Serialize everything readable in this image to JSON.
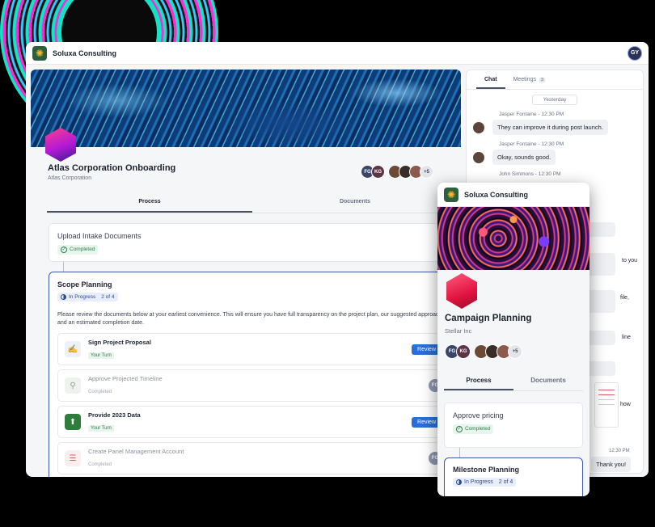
{
  "app": {
    "brand": "Soluxa Consulting",
    "user_initials": "GY",
    "accent_color": "#2a6fd6",
    "progress_color": "#3a5aa8",
    "success_color": "#2e7d4a"
  },
  "project": {
    "title": "Atlas Corporation Onboarding",
    "client": "Atlas Corporation",
    "members": [
      "FG",
      "KG"
    ],
    "more_members": "+5"
  },
  "tabs": [
    "Process",
    "Documents"
  ],
  "steps": {
    "upload": {
      "title": "Upload Intake Documents",
      "status": "Completed"
    },
    "scope": {
      "title": "Scope Planning",
      "status": "In Progress",
      "count": "2 of 4",
      "description": "Please review the documents below at your earliest convenience. This will ensure you have full transparency on the project plan, our suggested approach, and an estimated completion date."
    }
  },
  "tasks": [
    {
      "title": "Sign Project Proposal",
      "status": "Your Turn",
      "action": "Review",
      "icon": "signature-icon"
    },
    {
      "title": "Approve Projected Timeline",
      "status": "Completed",
      "assignee": "FG",
      "icon": "stamp-icon"
    },
    {
      "title": "Provide 2023 Data",
      "status": "Your Turn",
      "action": "Review",
      "icon": "upload-file-icon"
    },
    {
      "title": "Create Panel Management Account",
      "status": "Completed",
      "assignee": "FG",
      "icon": "form-icon"
    }
  ],
  "chat": {
    "tabs": {
      "chat": "Chat",
      "meetings": "Meetings",
      "meetings_count": "3"
    },
    "day": "Yesterday",
    "messages": [
      {
        "meta": "Jasper Fontaine - 12:30 PM",
        "text": "They can improve it during post launch."
      },
      {
        "meta": "Jasper Fontaine - 12:30 PM",
        "text": "Okay, sounds good."
      },
      {
        "meta": "John Simmons - 12:30 PM"
      }
    ],
    "partial_texts": [
      "to you",
      "file,",
      "line",
      "how"
    ],
    "last_time": "12:30 PM",
    "last_message": "Thank you!"
  },
  "card": {
    "brand": "Soluxa Consulting",
    "title": "Campaign Planning",
    "client": "Stellar Inc",
    "members": [
      "FG",
      "KG"
    ],
    "more_members": "+5",
    "tabs": [
      "Process",
      "Documents"
    ],
    "step1": {
      "title": "Approve pricing",
      "status": "Completed"
    },
    "step2": {
      "title": "Milestone Planning",
      "status": "In Progress",
      "count": "2 of 4"
    }
  }
}
